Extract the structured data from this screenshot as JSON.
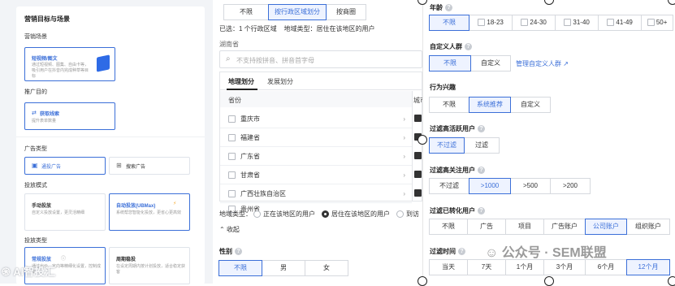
{
  "left": {
    "section_title": "营销目标与场景",
    "scene_label": "营销场景",
    "scene_card": {
      "title": "短视频/图文",
      "desc": "通过短视频、图集、自由卡等，吸引用户在抖音内完成种草等目标"
    },
    "goal_label": "推广目的",
    "goal_card": {
      "title": "获取线索",
      "desc": "提升表单数量"
    },
    "ad_type_label": "广告类型",
    "ad_type_options": [
      {
        "label": "通投广告",
        "icon": "grid-icon"
      },
      {
        "label": "搜索广告",
        "icon": "search-box-icon"
      }
    ],
    "mode_label": "投放模式",
    "mode_cards": [
      {
        "title": "手动投放",
        "desc": "自定义投放设置，更灵活精细"
      },
      {
        "title": "自动投放(UBMax)",
        "desc": "系统帮您智能化投放，更省心更高效"
      }
    ],
    "bid_label": "投放类型",
    "bid_cards": [
      {
        "title": "常规投放",
        "desc": "通过出价、定向等精细化设置，控制成本"
      },
      {
        "title": "周期稳投",
        "desc": "在设定周期内按计划投放，适合稳定获客"
      }
    ],
    "watermark": "AI智投汇"
  },
  "mid": {
    "top_tabs": [
      "不限",
      "按行政区域划分",
      "按商圈"
    ],
    "top_tab_active": 1,
    "selected_summary": "已选：1 个行政区域    地域类型：居住在该地区的用户",
    "province_label": "湖南省",
    "search_placeholder": "不支持按拼音、拼音首字母",
    "sub_tabs": [
      "地理划分",
      "发展划分"
    ],
    "col_province": "省份",
    "col_city": "城市",
    "provinces": [
      "重庆市",
      "福建省",
      "广东省",
      "甘肃省",
      "广西壮族自治区",
      "贵州省"
    ],
    "region_type_label": "地域类型：",
    "region_type_options": [
      "正在该地区的用户",
      "居住在该地区的用户",
      "到访"
    ],
    "region_type_selected": 1,
    "collapse": "收起",
    "gender_label": "性别",
    "gender_options": [
      "不限",
      "男",
      "女"
    ]
  },
  "right": {
    "age_label": "年龄",
    "age_options": [
      "不限",
      "18-23",
      "24-30",
      "31-40",
      "41-49",
      "50+"
    ],
    "custom_label": "自定义人群",
    "custom_options": [
      "不限",
      "自定义"
    ],
    "custom_link": "管理自定义人群",
    "behavior_label": "行为兴趣",
    "behavior_options": [
      "不限",
      "系统推荐",
      "自定义"
    ],
    "active_label": "过滤高活跃用户",
    "active_options": [
      "不过滤",
      "过滤"
    ],
    "follow_label": "过滤高关注用户",
    "follow_options": [
      "不过滤",
      ">1000",
      ">500",
      ">200"
    ],
    "converted_label": "过滤已转化用户",
    "converted_options": [
      "不限",
      "广告",
      "项目",
      "广告账户",
      "公司账户",
      "组织账户"
    ],
    "time_label": "过滤时间",
    "time_options": [
      "当天",
      "7天",
      "1个月",
      "3个月",
      "6个月",
      "12个月"
    ],
    "watermark": "公众号 · SEM联盟"
  }
}
